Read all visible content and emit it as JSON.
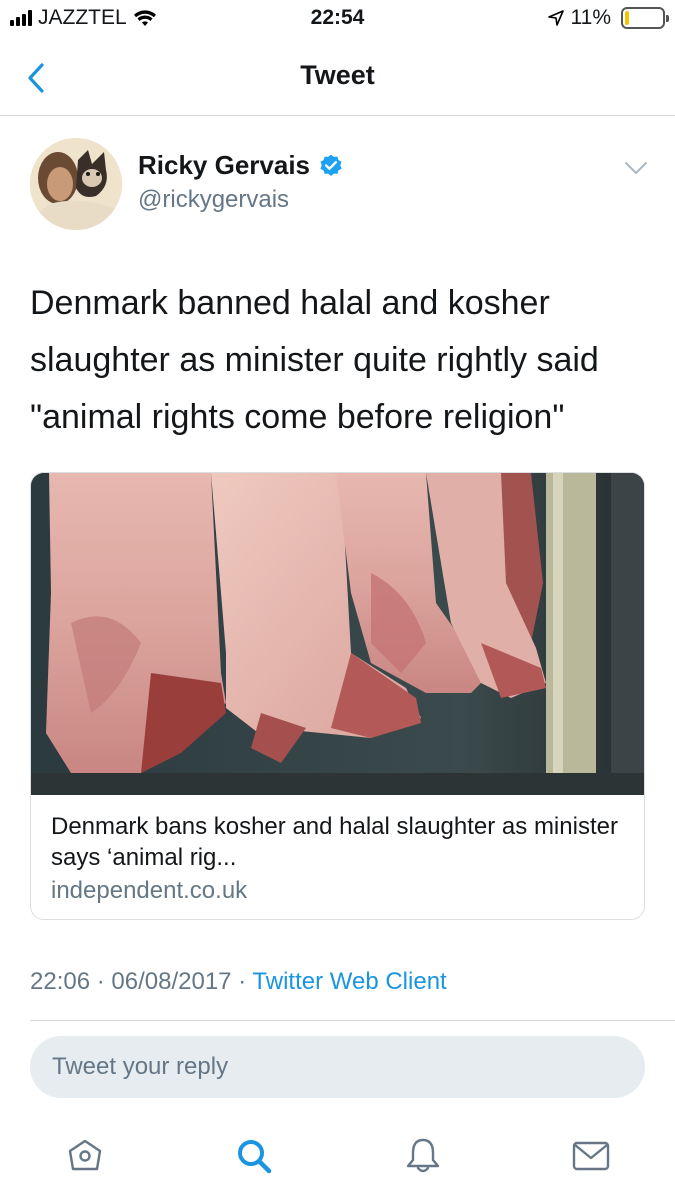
{
  "status_bar": {
    "carrier": "JAZZTEL",
    "time": "22:54",
    "battery_percent_label": "11%",
    "battery_level": 0.11
  },
  "nav": {
    "title": "Tweet",
    "back_icon": "chevron-left-icon"
  },
  "author": {
    "name": "Ricky Gervais",
    "handle": "@rickygervais",
    "verified": true
  },
  "tweet": {
    "text": "Denmark banned halal and kosher slaughter as minister quite rightly said \"animal rights come before religion\""
  },
  "card": {
    "title": "Denmark bans kosher and halal slaughter as minister says ‘animal rig...",
    "domain": "independent.co.uk"
  },
  "meta": {
    "time": "22:06",
    "date": "06/08/2017",
    "separator": " · ",
    "client": "Twitter Web Client"
  },
  "reply": {
    "placeholder": "Tweet your reply"
  },
  "tabs": [
    {
      "icon": "home-icon"
    },
    {
      "icon": "search-icon"
    },
    {
      "icon": "bell-icon"
    },
    {
      "icon": "mail-icon"
    }
  ],
  "colors": {
    "accent": "#1b95e0",
    "secondary_text": "#657786",
    "battery_low": "#f5c400"
  }
}
